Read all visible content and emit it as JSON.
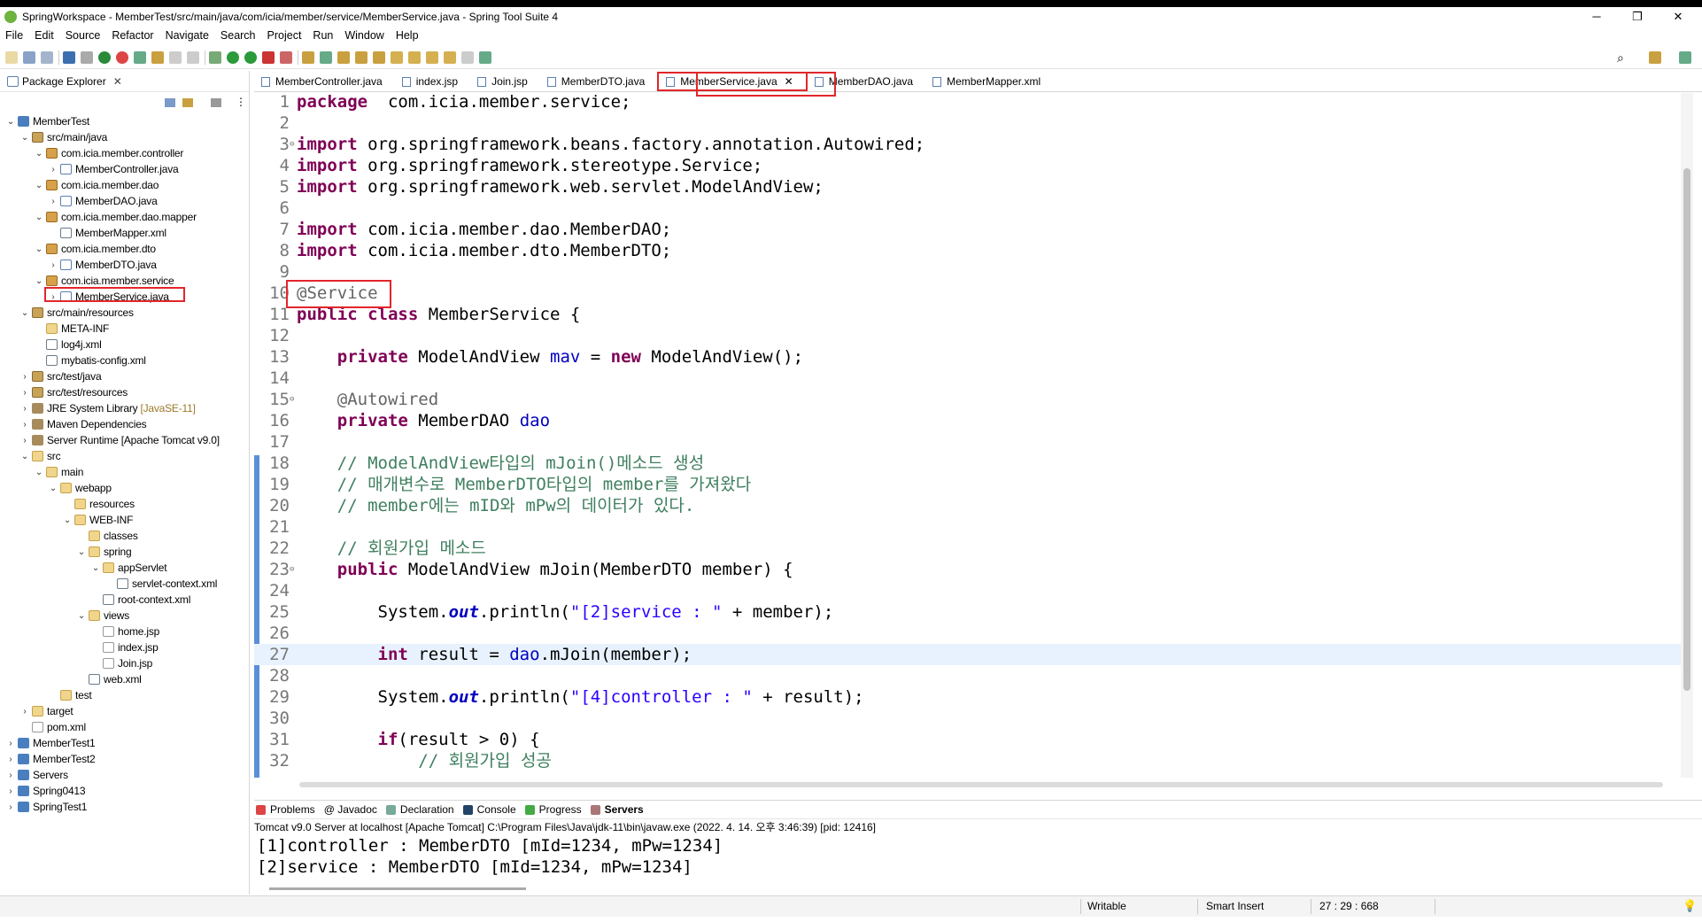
{
  "window": {
    "title": "SpringWorkspace - MemberTest/src/main/java/com/icia/member/service/MemberService.java - Spring Tool Suite 4",
    "minimize": "─",
    "maximize": "❐",
    "close": "✕"
  },
  "menu": [
    "File",
    "Edit",
    "Source",
    "Refactor",
    "Navigate",
    "Search",
    "Project",
    "Run",
    "Window",
    "Help"
  ],
  "explorer": {
    "title": "Package Explorer",
    "close": "✕",
    "rows": [
      {
        "toggle": "⌄",
        "icon": "proj",
        "label": "MemberTest",
        "decor": ""
      },
      {
        "toggle": "⌄",
        "icon": "src",
        "label": "src/main/java",
        "decor": ""
      },
      {
        "toggle": "⌄",
        "icon": "pkg",
        "label": "com.icia.member.controller",
        "decor": ""
      },
      {
        "toggle": "›",
        "icon": "java",
        "label": "MemberController.java",
        "decor": ""
      },
      {
        "toggle": "⌄",
        "icon": "pkg",
        "label": "com.icia.member.dao",
        "decor": ""
      },
      {
        "toggle": "›",
        "icon": "java",
        "label": "MemberDAO.java",
        "decor": ""
      },
      {
        "toggle": "⌄",
        "icon": "pkg",
        "label": "com.icia.member.dao.mapper",
        "decor": ""
      },
      {
        "toggle": "",
        "icon": "xml",
        "label": "MemberMapper.xml",
        "decor": ""
      },
      {
        "toggle": "⌄",
        "icon": "pkg",
        "label": "com.icia.member.dto",
        "decor": ""
      },
      {
        "toggle": "›",
        "icon": "java",
        "label": "MemberDTO.java",
        "decor": ""
      },
      {
        "toggle": "⌄",
        "icon": "pkg",
        "label": "com.icia.member.service",
        "decor": ""
      },
      {
        "toggle": "›",
        "icon": "java",
        "label": "MemberService.java",
        "decor": ""
      },
      {
        "toggle": "⌄",
        "icon": "src",
        "label": "src/main/resources",
        "decor": ""
      },
      {
        "toggle": "",
        "icon": "folder",
        "label": "META-INF",
        "decor": ""
      },
      {
        "toggle": "",
        "icon": "xml",
        "label": "log4j.xml",
        "decor": ""
      },
      {
        "toggle": "",
        "icon": "xml",
        "label": "mybatis-config.xml",
        "decor": ""
      },
      {
        "toggle": "›",
        "icon": "src",
        "label": "src/test/java",
        "decor": ""
      },
      {
        "toggle": "›",
        "icon": "src",
        "label": "src/test/resources",
        "decor": ""
      },
      {
        "toggle": "›",
        "icon": "lib",
        "label": "JRE System Library",
        "decor": "[JavaSE-11]"
      },
      {
        "toggle": "›",
        "icon": "lib",
        "label": "Maven Dependencies",
        "decor": ""
      },
      {
        "toggle": "›",
        "icon": "lib",
        "label": "Server Runtime [Apache Tomcat v9.0]",
        "decor": ""
      },
      {
        "toggle": "⌄",
        "icon": "folder",
        "label": "src",
        "decor": ""
      },
      {
        "toggle": "⌄",
        "icon": "folder",
        "label": "main",
        "decor": ""
      },
      {
        "toggle": "⌄",
        "icon": "folder",
        "label": "webapp",
        "decor": ""
      },
      {
        "toggle": "",
        "icon": "folder",
        "label": "resources",
        "decor": ""
      },
      {
        "toggle": "⌄",
        "icon": "folder",
        "label": "WEB-INF",
        "decor": ""
      },
      {
        "toggle": "",
        "icon": "folder",
        "label": "classes",
        "decor": ""
      },
      {
        "toggle": "⌄",
        "icon": "folder",
        "label": "spring",
        "decor": ""
      },
      {
        "toggle": "⌄",
        "icon": "folder",
        "label": "appServlet",
        "decor": ""
      },
      {
        "toggle": "",
        "icon": "xml",
        "label": "servlet-context.xml",
        "decor": ""
      },
      {
        "toggle": "",
        "icon": "xml",
        "label": "root-context.xml",
        "decor": ""
      },
      {
        "toggle": "⌄",
        "icon": "folder",
        "label": "views",
        "decor": ""
      },
      {
        "toggle": "",
        "icon": "file",
        "label": "home.jsp",
        "decor": ""
      },
      {
        "toggle": "",
        "icon": "file",
        "label": "index.jsp",
        "decor": ""
      },
      {
        "toggle": "",
        "icon": "file",
        "label": "Join.jsp",
        "decor": ""
      },
      {
        "toggle": "",
        "icon": "xml",
        "label": "web.xml",
        "decor": ""
      },
      {
        "toggle": "",
        "icon": "folder",
        "label": "test",
        "decor": ""
      },
      {
        "toggle": "›",
        "icon": "folder",
        "label": "target",
        "decor": ""
      },
      {
        "toggle": "",
        "icon": "file",
        "label": "pom.xml",
        "decor": ""
      },
      {
        "toggle": "›",
        "icon": "proj",
        "label": "MemberTest1",
        "decor": ""
      },
      {
        "toggle": "›",
        "icon": "proj",
        "label": "MemberTest2",
        "decor": ""
      },
      {
        "toggle": "›",
        "icon": "proj",
        "label": "Servers",
        "decor": ""
      },
      {
        "toggle": "›",
        "icon": "proj",
        "label": "Spring0413",
        "decor": ""
      },
      {
        "toggle": "›",
        "icon": "proj",
        "label": "SpringTest1",
        "decor": ""
      }
    ]
  },
  "editor": {
    "tabs": [
      "MemberController.java",
      "index.jsp",
      "Join.jsp",
      "MemberDTO.java",
      "MemberService.java",
      "MemberDAO.java",
      "MemberMapper.xml"
    ],
    "active_tab": "MemberService.java",
    "tab_close": "✕",
    "lines": [
      {
        "n": "1",
        "fold": "",
        "segs": [
          [
            "kw",
            "package"
          ],
          [
            "",
            "  com.icia.member.service;"
          ]
        ]
      },
      {
        "n": "2",
        "fold": "",
        "segs": []
      },
      {
        "n": "3",
        "fold": "⊖",
        "segs": [
          [
            "kw",
            "import"
          ],
          [
            "",
            " org.springframework.beans.factory.annotation.Autowired;"
          ]
        ]
      },
      {
        "n": "4",
        "fold": "",
        "segs": [
          [
            "kw",
            "import"
          ],
          [
            "",
            " org.springframework.stereotype.Service;"
          ]
        ]
      },
      {
        "n": "5",
        "fold": "",
        "segs": [
          [
            "kw",
            "import"
          ],
          [
            "",
            " org.springframework.web.servlet.ModelAndView;"
          ]
        ]
      },
      {
        "n": "6",
        "fold": "",
        "segs": []
      },
      {
        "n": "7",
        "fold": "",
        "segs": [
          [
            "kw",
            "import"
          ],
          [
            "",
            " com.icia.member.dao.MemberDAO;"
          ]
        ]
      },
      {
        "n": "8",
        "fold": "",
        "segs": [
          [
            "kw",
            "import"
          ],
          [
            "",
            " com.icia.member.dto.MemberDTO;"
          ]
        ]
      },
      {
        "n": "9",
        "fold": "",
        "segs": []
      },
      {
        "n": "10",
        "fold": "",
        "segs": [
          [
            "ann",
            "@Service"
          ]
        ]
      },
      {
        "n": "11",
        "fold": "",
        "segs": [
          [
            "kw",
            "public"
          ],
          [
            "",
            " "
          ],
          [
            "kw",
            "class"
          ],
          [
            "",
            " MemberService {"
          ]
        ]
      },
      {
        "n": "12",
        "fold": "",
        "segs": []
      },
      {
        "n": "13",
        "fold": "",
        "segs": [
          [
            "",
            "    "
          ],
          [
            "kw",
            "private"
          ],
          [
            "",
            " ModelAndView "
          ],
          [
            "fld",
            "mav"
          ],
          [
            "",
            " = "
          ],
          [
            "kw",
            "new"
          ],
          [
            "",
            " ModelAndView();"
          ]
        ]
      },
      {
        "n": "14",
        "fold": "",
        "segs": []
      },
      {
        "n": "15",
        "fold": "⊖",
        "segs": [
          [
            "",
            "    "
          ],
          [
            "ann",
            "@Autowired"
          ]
        ]
      },
      {
        "n": "16",
        "fold": "",
        "segs": [
          [
            "",
            "    "
          ],
          [
            "kw",
            "private"
          ],
          [
            "",
            " MemberDAO "
          ],
          [
            "fld",
            "dao"
          ],
          [
            ";"
          ]
        ]
      },
      {
        "n": "17",
        "fold": "",
        "segs": []
      },
      {
        "n": "18",
        "fold": "",
        "segs": [
          [
            "",
            "    "
          ],
          [
            "cmt",
            "// ModelAndView타입의 mJoin()메소드 생성"
          ]
        ]
      },
      {
        "n": "19",
        "fold": "",
        "segs": [
          [
            "",
            "    "
          ],
          [
            "cmt",
            "// 매개변수로 MemberDTO타입의 member를 가져왔다"
          ]
        ]
      },
      {
        "n": "20",
        "fold": "",
        "segs": [
          [
            "",
            "    "
          ],
          [
            "cmt",
            "// member에는 mID와 mPw의 데이터가 있다."
          ]
        ]
      },
      {
        "n": "21",
        "fold": "",
        "segs": []
      },
      {
        "n": "22",
        "fold": "",
        "segs": [
          [
            "",
            "    "
          ],
          [
            "cmt",
            "// 회원가입 메소드"
          ]
        ]
      },
      {
        "n": "23",
        "fold": "⊖",
        "segs": [
          [
            "",
            "    "
          ],
          [
            "kw",
            "public"
          ],
          [
            "",
            " ModelAndView mJoin(MemberDTO member) {"
          ]
        ]
      },
      {
        "n": "24",
        "fold": "",
        "segs": []
      },
      {
        "n": "25",
        "fold": "",
        "segs": [
          [
            "",
            "        System."
          ],
          [
            "stf",
            "out"
          ],
          [
            "",
            ".println("
          ],
          [
            "str",
            "\"[2]service : \""
          ],
          [
            "",
            " + member);"
          ]
        ]
      },
      {
        "n": "26",
        "fold": "",
        "segs": []
      },
      {
        "n": "27",
        "fold": "",
        "segs": [
          [
            "",
            "        "
          ],
          [
            "kw",
            "int"
          ],
          [
            "",
            " result = "
          ],
          [
            "fld",
            "dao"
          ],
          [
            "",
            ".mJoin(member);"
          ]
        ]
      },
      {
        "n": "28",
        "fold": "",
        "segs": []
      },
      {
        "n": "29",
        "fold": "",
        "segs": [
          [
            "",
            "        System."
          ],
          [
            "stf",
            "out"
          ],
          [
            "",
            ".println("
          ],
          [
            "str",
            "\"[4]controller : \""
          ],
          [
            "",
            " + result);"
          ]
        ]
      },
      {
        "n": "30",
        "fold": "",
        "segs": []
      },
      {
        "n": "31",
        "fold": "",
        "segs": [
          [
            "",
            "        "
          ],
          [
            "kw",
            "if"
          ],
          [
            "",
            "(result > 0) {"
          ]
        ]
      },
      {
        "n": "32",
        "fold": "",
        "segs": [
          [
            "",
            "            "
          ],
          [
            "cmt",
            "// 회원가입 성공"
          ]
        ]
      }
    ]
  },
  "console": {
    "tabs": [
      {
        "label": "Problems",
        "color": "#d44"
      },
      {
        "label": "@ Javadoc",
        "color": ""
      },
      {
        "label": "Declaration",
        "color": "#7a9"
      },
      {
        "label": "Console",
        "color": "#246"
      },
      {
        "label": "Progress",
        "color": "#4a4"
      },
      {
        "label": "Servers",
        "color": "#a77"
      }
    ],
    "description": "Tomcat v9.0 Server at localhost [Apache Tomcat] C:\\Program Files\\Java\\jdk-11\\bin\\javaw.exe  (2022. 4. 14. 오후 3:46:39) [pid: 12416]",
    "output": [
      "[1]controller : MemberDTO [mId=1234, mPw=1234]",
      "[2]service : MemberDTO [mId=1234, mPw=1234]"
    ]
  },
  "status": {
    "writable": "Writable",
    "insert_mode": "Smart Insert",
    "position": "27 : 29 : 668"
  },
  "colors": {
    "highlight": "#e2262b",
    "keyword": "#7f0055",
    "comment": "#3f7f5f",
    "string": "#2a00ff",
    "field": "#0000c0"
  }
}
